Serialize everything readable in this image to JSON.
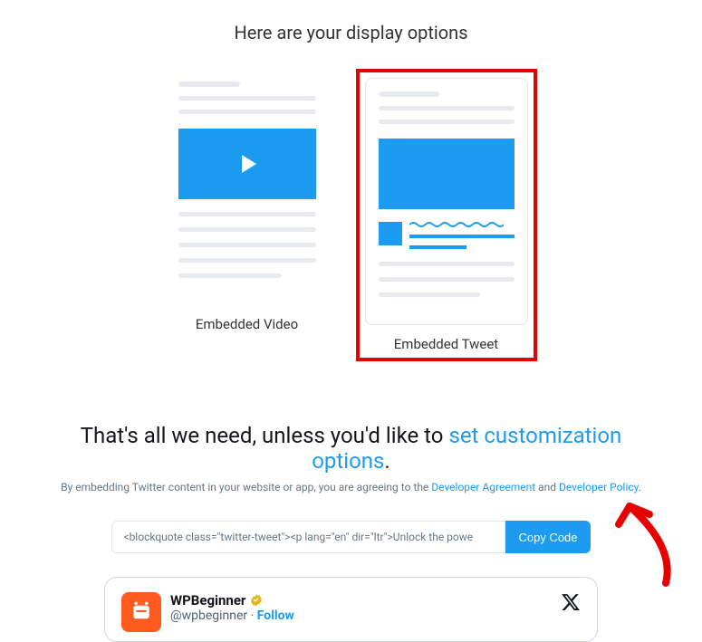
{
  "header": {
    "title": "Here are your display options"
  },
  "options": {
    "video_label": "Embedded Video",
    "tweet_label": "Embedded Tweet"
  },
  "confirm": {
    "lead": "That's all we need, unless you'd like to ",
    "link": "set customization options",
    "tail": ".",
    "fine_lead": "By embedding Twitter content in your website or app, you are agreeing to the ",
    "dev_agreement": "Developer Agreement",
    "and": " and ",
    "dev_policy": "Developer Policy",
    "fine_tail": "."
  },
  "code": {
    "snippet": "<blockquote class=\"twitter-tweet\"><p lang=\"en\" dir=\"ltr\">Unlock the powe",
    "copy_label": "Copy Code"
  },
  "preview": {
    "name": "WPBeginner",
    "handle": "@wpbeginner",
    "sep": " · ",
    "follow": "Follow"
  },
  "colors": {
    "accent": "#1d9bf0",
    "highlight": "#e60000"
  }
}
